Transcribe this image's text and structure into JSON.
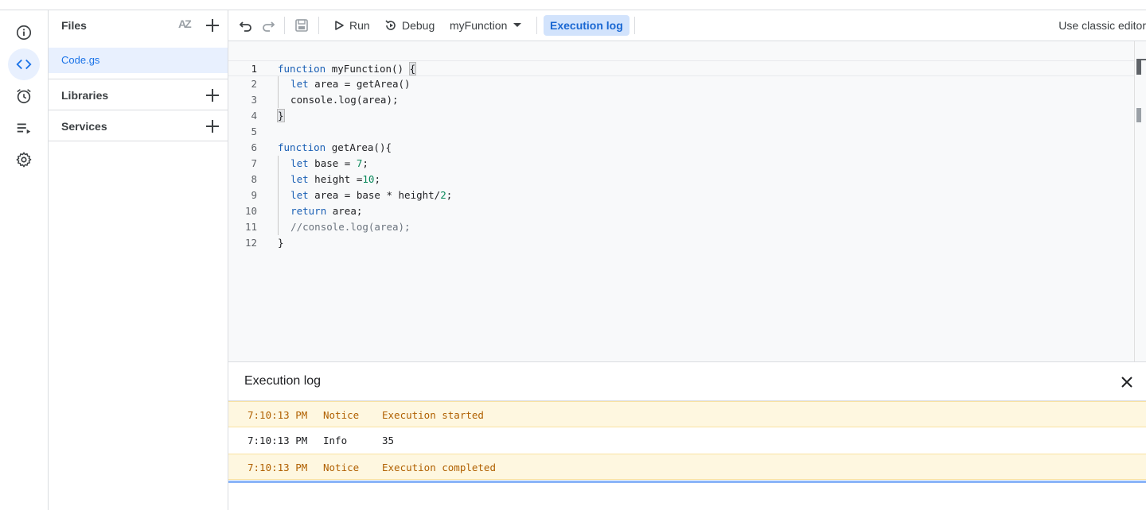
{
  "rail": {
    "items": [
      {
        "icon": "info-icon"
      },
      {
        "icon": "code-icon"
      },
      {
        "icon": "alarm-icon"
      },
      {
        "icon": "executions-icon"
      },
      {
        "icon": "gear-icon"
      }
    ]
  },
  "files_panel": {
    "title": "Files",
    "sort_icon_text": "AZ",
    "files": [
      "Code.gs"
    ],
    "libraries_label": "Libraries",
    "services_label": "Services"
  },
  "toolbar": {
    "run_label": "Run",
    "debug_label": "Debug",
    "function_selected": "myFunction",
    "execution_log_label": "Execution log",
    "classic_editor_label": "Use classic editor"
  },
  "editor": {
    "line_numbers": [
      "1",
      "2",
      "3",
      "4",
      "5",
      "6",
      "7",
      "8",
      "9",
      "10",
      "11",
      "12"
    ],
    "lines": [
      "function myFunction() {",
      "  let area = getArea()",
      "  console.log(area);",
      "}",
      "",
      "function getArea(){",
      "  let base = 7;",
      "  let height =10;",
      "  let area = base * height/2;",
      "  return area;",
      "  //console.log(area);",
      "}"
    ]
  },
  "log": {
    "title": "Execution log",
    "entries": [
      {
        "time": "7:10:13 PM",
        "severity": "Notice",
        "message": "Execution started"
      },
      {
        "time": "7:10:13 PM",
        "severity": "Info",
        "message": "35"
      },
      {
        "time": "7:10:13 PM",
        "severity": "Notice",
        "message": "Execution completed"
      }
    ]
  },
  "colors": {
    "accent": "#1a73e8",
    "notice_bg": "#fef7e0",
    "notice_text": "#b06000",
    "active_bg": "#e8f0fe"
  }
}
